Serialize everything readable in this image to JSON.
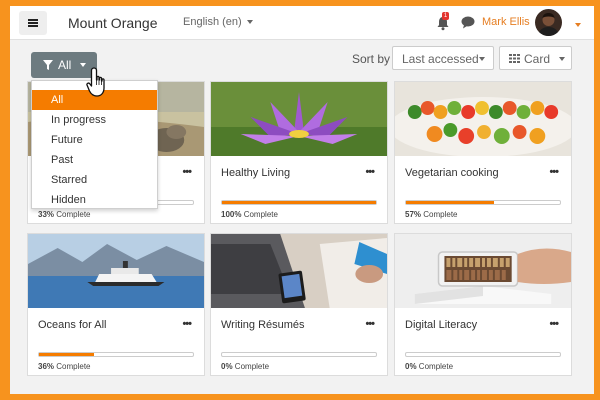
{
  "navbar": {
    "site_name": "Mount Orange",
    "language": "English (en)",
    "notification_count": "1",
    "user_name": "Mark Ellis"
  },
  "controls": {
    "filter_label": "All",
    "sort_label": "Sort by",
    "sort_value": "Last accessed",
    "view_value": "Card"
  },
  "filter_menu": {
    "items": [
      "All",
      "In progress",
      "Future",
      "Past",
      "Starred",
      "Hidden"
    ],
    "selected": "All"
  },
  "courses": [
    {
      "title": "",
      "progress": 33,
      "progress_label": "33%",
      "complete_label": "Complete"
    },
    {
      "title": "Healthy Living",
      "progress": 100,
      "progress_label": "100%",
      "complete_label": "Complete"
    },
    {
      "title": "Vegetarian cooking",
      "progress": 57,
      "progress_label": "57%",
      "complete_label": "Complete"
    },
    {
      "title": "Oceans for All",
      "progress": 36,
      "progress_label": "36%",
      "complete_label": "Complete"
    },
    {
      "title": "Writing Résumés",
      "progress": 0,
      "progress_label": "0%",
      "complete_label": "Complete"
    },
    {
      "title": "Digital Literacy",
      "progress": 0,
      "progress_label": "0%",
      "complete_label": "Complete"
    }
  ],
  "colors": {
    "accent": "#f57c00",
    "frame": "#f7931e",
    "filter_button": "#6d7b80"
  },
  "icons": [
    "menu-icon",
    "bell-icon",
    "chat-icon",
    "funnel-icon",
    "grid-icon",
    "hand-pointer-icon",
    "more-icon"
  ]
}
